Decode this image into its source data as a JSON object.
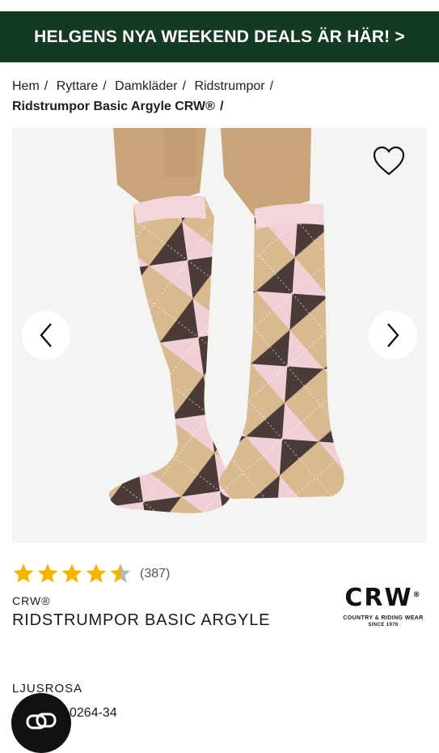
{
  "banner": {
    "text": "HELGENS NYA WEEKEND DEALS ÄR HÄR! >"
  },
  "breadcrumb": {
    "items": [
      "Hem",
      "Ryttare",
      "Damkläder",
      "Ridstrumpor"
    ],
    "separator": "/",
    "current": "Ridstrumpor Basic Argyle CRW®"
  },
  "gallery": {
    "prev_icon": "chevron-left-icon",
    "next_icon": "chevron-right-icon",
    "favorite_icon": "heart-outline-icon"
  },
  "rating": {
    "value": 4.5,
    "max": 5,
    "count_label": "(387)",
    "star_color": "#f5b400"
  },
  "product": {
    "brand": "CRW®",
    "name": "RIDSTRUMPOR BASIC ARGYLE",
    "color": "LJUSROSA",
    "sku": "0264-34"
  },
  "brand_logo": {
    "word": "CRW",
    "mark": "®",
    "tagline": "COUNTRY & RIDING WEAR",
    "since": "SINCE 1976"
  },
  "chat": {
    "icon": "chat-bubbles-icon"
  },
  "colors": {
    "banner_bg": "#143a23",
    "sock_pink": "#f1cfd6",
    "sock_tan": "#d9b98f",
    "sock_brown": "#4a3b37"
  }
}
